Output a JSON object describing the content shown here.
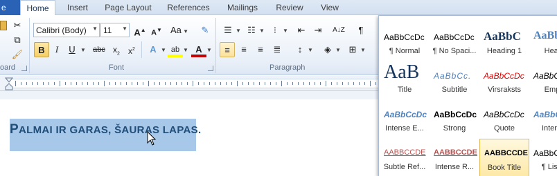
{
  "tabs": {
    "file": "e",
    "items": [
      "Home",
      "Insert",
      "Page Layout",
      "References",
      "Mailings",
      "Review",
      "View"
    ],
    "active": "Home"
  },
  "clipboard": {
    "label": "oard"
  },
  "font": {
    "label": "Font",
    "name": "Calibri (Body)",
    "size": "11",
    "grow": "A",
    "shrink": "A",
    "change_case": "Aa",
    "bold": "B",
    "italic": "I",
    "underline": "U",
    "strikethrough": "abc",
    "subscript": "x",
    "superscript": "x",
    "text_effects": "A",
    "highlight": "ab",
    "font_color": "A"
  },
  "paragraph": {
    "label": "Paragraph",
    "sort": "A↓Z",
    "pilcrow": "¶"
  },
  "document": {
    "text_first": "P",
    "text_rest": "ALMAI IR GARAS, ŠAURAS LAPAS."
  },
  "styles": [
    {
      "preview": "AaBbCcDc",
      "label": "¶ Normal",
      "style": "normal"
    },
    {
      "preview": "AaBbCcDc",
      "label": "¶ No Spaci...",
      "style": "normal"
    },
    {
      "preview": "AaBbC",
      "label": "Heading 1",
      "style": "h1"
    },
    {
      "preview": "AaBbC",
      "label": "Headi",
      "style": "h2"
    },
    {
      "preview": "AaB",
      "label": "Title",
      "style": "title"
    },
    {
      "preview": "AaBbCc.",
      "label": "Subtitle",
      "style": "subtitle"
    },
    {
      "preview": "AaBbCcDc",
      "label": "Virsraksts",
      "style": "virsraksts"
    },
    {
      "preview": "AaBbCcDc",
      "label": "Emph",
      "style": "emph"
    },
    {
      "preview": "AaBbCcDc",
      "label": "Intense E...",
      "style": "intense-e"
    },
    {
      "preview": "AaBbCcDc",
      "label": "Strong",
      "style": "strong"
    },
    {
      "preview": "AaBbCcDc",
      "label": "Quote",
      "style": "quote"
    },
    {
      "preview": "AaBbCcDc",
      "label": "Intense",
      "style": "intense-q"
    },
    {
      "preview": "AABBCCDE",
      "label": "Subtle Ref...",
      "style": "subtle-ref"
    },
    {
      "preview": "AABBCCDE",
      "label": "Intense R...",
      "style": "intense-ref"
    },
    {
      "preview": "AABBCCDE",
      "label": "Book Title",
      "style": "book-title"
    },
    {
      "preview": "AaBbCcDc",
      "label": "¶ List P",
      "style": "list"
    }
  ],
  "selected_style": "Book Title",
  "colors": {
    "file_tab": "#2a62b5",
    "selection": "#a8c8ea",
    "heading_blue": "#17365d",
    "intense_red": "#c0504d"
  }
}
